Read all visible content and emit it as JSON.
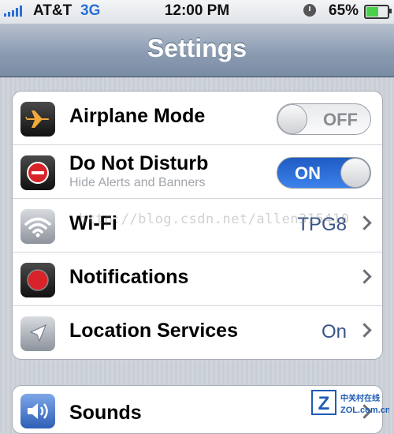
{
  "statusbar": {
    "carrier": "AT&T",
    "network": "3G",
    "time": "12:00 PM",
    "battery": "65%",
    "battery_level": 0.65
  },
  "navbar": {
    "title": "Settings"
  },
  "group1": [
    {
      "label": "Airplane Mode",
      "toggle": "OFF",
      "icon": "airplane-icon"
    },
    {
      "label": "Do Not Disturb",
      "sublabel": "Hide Alerts and Banners",
      "toggle": "ON",
      "icon": "do-not-disturb-icon"
    },
    {
      "label": "Wi-Fi",
      "value": "TPG8",
      "icon": "wifi-icon"
    },
    {
      "label": "Notifications",
      "icon": "notifications-icon"
    },
    {
      "label": "Location Services",
      "value": "On",
      "icon": "location-arrow-icon"
    }
  ],
  "group2": [
    {
      "label": "Sounds",
      "icon": "speaker-icon"
    }
  ],
  "watermark": "http://blog.csdn.net/allen315410",
  "logo": {
    "chinese": "中关村在线",
    "domain": "ZOL.com.cn",
    "letter": "Z"
  }
}
